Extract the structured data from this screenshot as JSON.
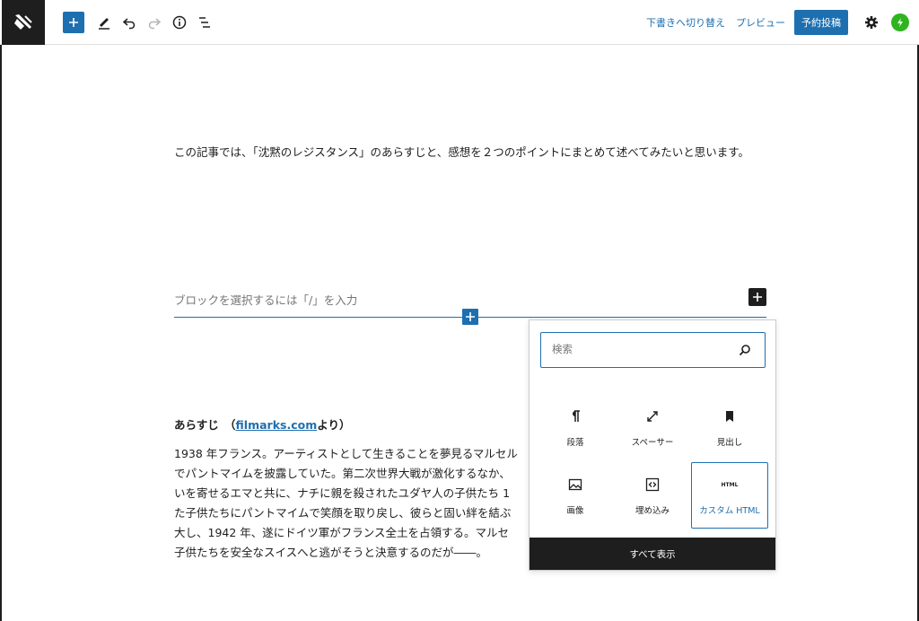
{
  "toolbar": {
    "switch_draft": "下書きへ切り替え",
    "preview": "プレビュー",
    "schedule": "予約投稿"
  },
  "editor": {
    "intro": "この記事では、「沈黙のレジスタンス」のあらすじと、感想を２つのポイントにまとめて述べてみたいと思います。",
    "appender_placeholder": "ブロックを選択するには「/」を入力",
    "heading_prefix": "あらすじ　（",
    "heading_link": "filmarks.com",
    "heading_suffix": "より）",
    "synopsis_lines": [
      "1938 年フランス。アーティストとして生きることを夢見るマルセル",
      "でパントマイムを披露していた。第二次世界大戦が激化するなか、",
      "いを寄せるエマと共に、ナチに親を殺されたユダヤ人の子供たち 1",
      "た子供たちにパントマイムで笑顔を取り戻し、彼らと固い絆を結ぶ",
      "大し、1942 年、遂にドイツ軍がフランス全土を占領する。マルセ",
      "子供たちを安全なスイスへと逃がそうと決意するのだが――。"
    ]
  },
  "inserter": {
    "search_placeholder": "検索",
    "blocks": [
      {
        "label": "段落",
        "icon": "paragraph-icon"
      },
      {
        "label": "スペーサー",
        "icon": "spacer-icon"
      },
      {
        "label": "見出し",
        "icon": "heading-bookmark-icon"
      },
      {
        "label": "画像",
        "icon": "image-icon"
      },
      {
        "label": "埋め込み",
        "icon": "embed-icon"
      },
      {
        "label": "カスタム HTML",
        "icon": "html-icon",
        "icon_text": "HTML"
      }
    ],
    "show_all": "すべて表示"
  }
}
